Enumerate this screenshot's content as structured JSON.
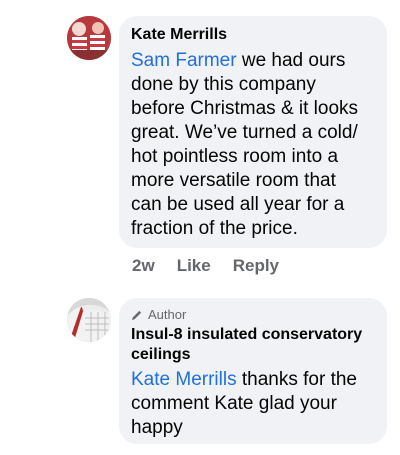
{
  "comments": [
    {
      "author": "Kate Merrills",
      "mention": "Sam Farmer",
      "text": " we had ours done by this company before Christmas & it looks great. We’ve turned a cold/ hot pointless room into a more versatile room that can be used all year for a fraction of the price.",
      "age": "2w",
      "like_label": "Like",
      "reply_label": "Reply"
    },
    {
      "badge": "Author",
      "author": "Insul-8 insulated conservatory ceilings",
      "mention": "Kate Merrills",
      "text": " thanks for the comment Kate glad your happy"
    }
  ]
}
